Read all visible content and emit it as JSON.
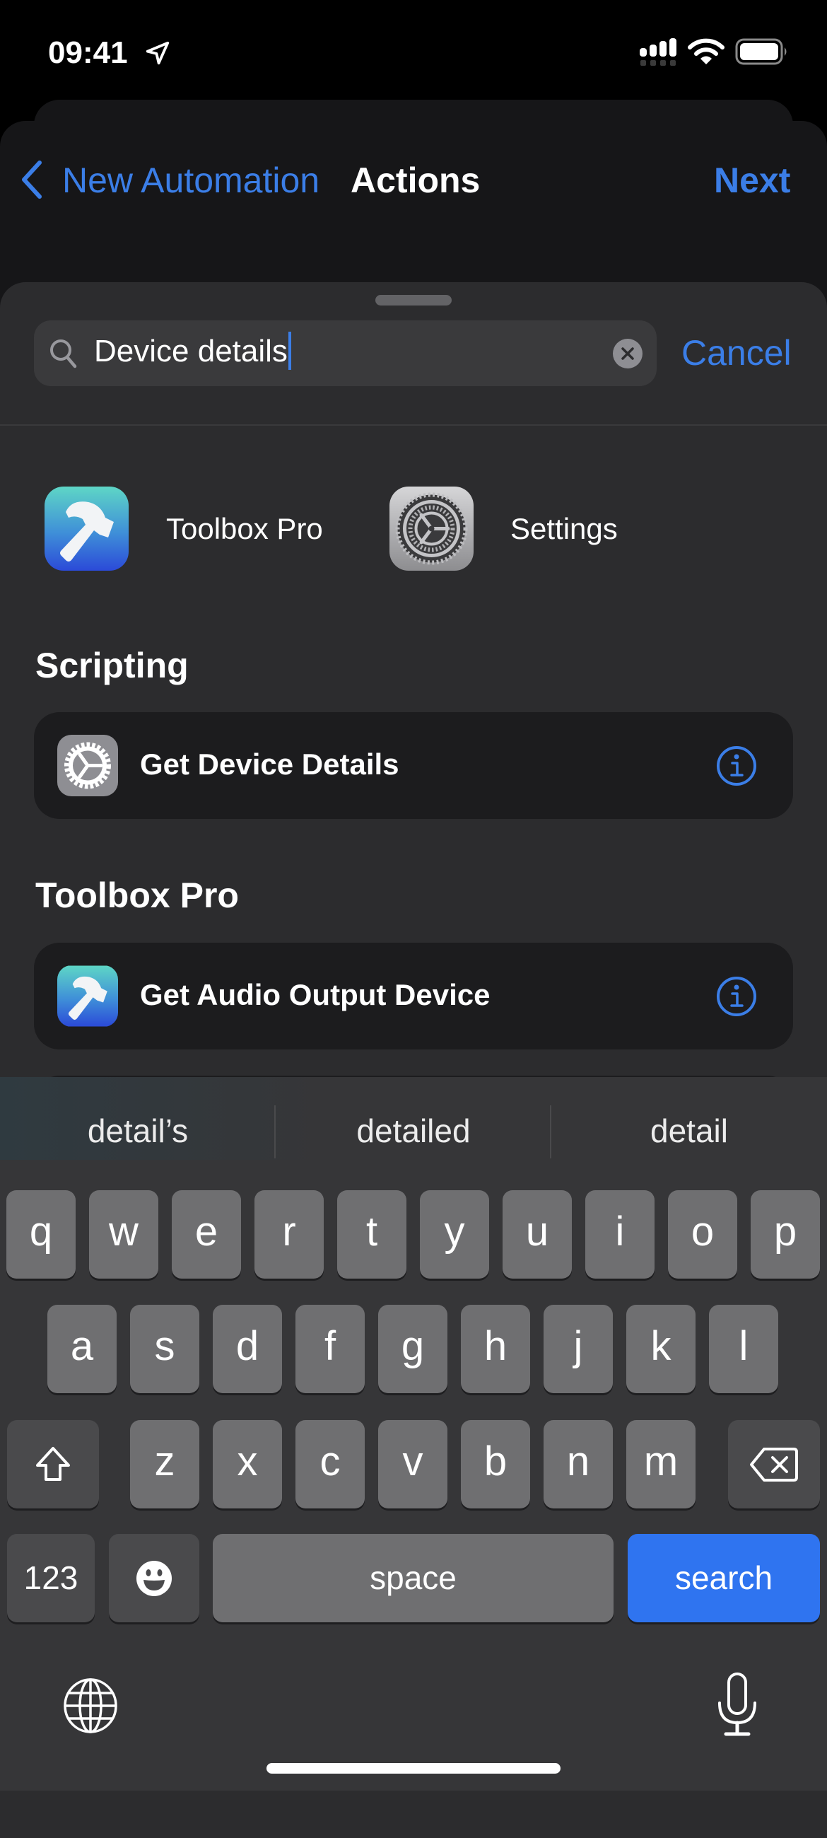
{
  "status_bar": {
    "time": "09:41",
    "icons": [
      "location-arrow-icon",
      "cellular-signal-icon",
      "wifi-icon",
      "battery-icon"
    ]
  },
  "nav": {
    "back_label": "New Automation",
    "title": "Actions",
    "next_label": "Next"
  },
  "search": {
    "value": "Device details",
    "cancel_label": "Cancel"
  },
  "apps": [
    {
      "name": "Toolbox Pro",
      "icon": "toolbox-pro-app-icon"
    },
    {
      "name": "Settings",
      "icon": "settings-app-icon"
    }
  ],
  "sections": [
    {
      "header": "Scripting",
      "actions": [
        {
          "label": "Get Device Details",
          "icon": "settings-gear-icon"
        }
      ]
    },
    {
      "header": "Toolbox Pro",
      "actions": [
        {
          "label": "Get Audio Output Device",
          "icon": "toolbox-pro-hammer-icon"
        }
      ]
    }
  ],
  "keyboard": {
    "suggestions": [
      "detail’s",
      "detailed",
      "detail"
    ],
    "rows": [
      [
        "q",
        "w",
        "e",
        "r",
        "t",
        "y",
        "u",
        "i",
        "o",
        "p"
      ],
      [
        "a",
        "s",
        "d",
        "f",
        "g",
        "h",
        "j",
        "k",
        "l"
      ],
      [
        "z",
        "x",
        "c",
        "v",
        "b",
        "n",
        "m"
      ]
    ],
    "numbers_label": "123",
    "space_label": "space",
    "return_label": "search"
  },
  "colors": {
    "accent": "#3b7ee7",
    "search_key": "#2f74f0",
    "sheet": "#2c2c2e",
    "card": "#1c1c1e",
    "key": "#6f6f71",
    "special_key": "#4a4a4c"
  }
}
